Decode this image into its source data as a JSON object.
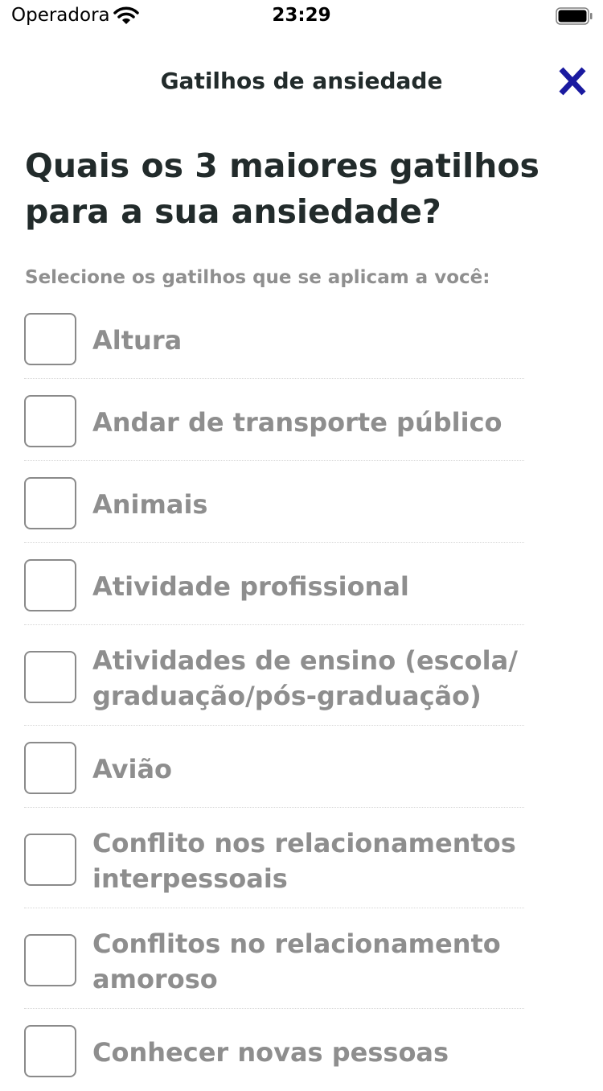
{
  "status_bar": {
    "carrier": "Operadora",
    "time": "23:29"
  },
  "header": {
    "title": "Gatilhos de ansiedade",
    "close_icon": "close-icon",
    "accent_color": "#1a1aa0"
  },
  "question": "Quais os 3 maiores gatilhos para a sua ansiedade?",
  "instruction": "Selecione os gatilhos que se aplicam a você:",
  "triggers": [
    {
      "label": "Altura",
      "checked": false
    },
    {
      "label": "Andar de transporte público",
      "checked": false
    },
    {
      "label": "Animais",
      "checked": false
    },
    {
      "label": "Atividade profissional",
      "checked": false
    },
    {
      "label": "Atividades de ensino (escola/ graduação/pós-graduação)",
      "checked": false
    },
    {
      "label": "Avião",
      "checked": false
    },
    {
      "label": "Conflito nos relacionamentos interpessoais",
      "checked": false
    },
    {
      "label": "Conflitos no relacionamento amoroso",
      "checked": false
    },
    {
      "label": "Conhecer novas pessoas",
      "checked": false
    }
  ]
}
